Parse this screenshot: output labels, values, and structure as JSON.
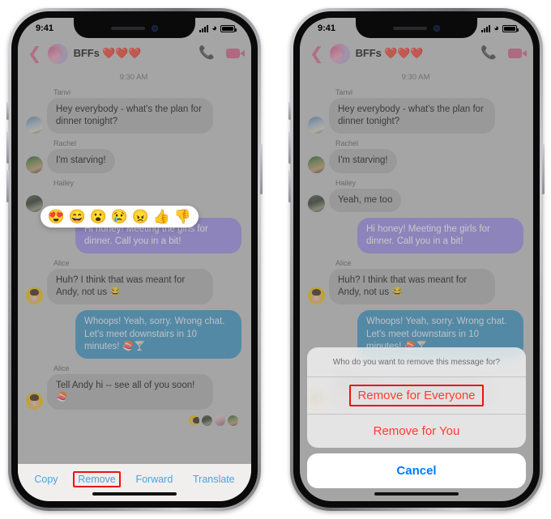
{
  "status_bar": {
    "time": "9:41",
    "signal_icon": "cellular-bars-icon",
    "wifi_icon": "wifi-icon",
    "battery_icon": "battery-full-icon"
  },
  "chat_header": {
    "back_icon": "back-chevron-icon",
    "avatar_icon": "group-avatar",
    "title": "BFFs ❤️❤️❤️",
    "call_icon": "phone-call-icon",
    "video_icon": "video-call-icon"
  },
  "conversation": {
    "timestamp": "9:30 AM",
    "messages": [
      {
        "sender": "Tanvi",
        "text": "Hey everybody - what's the plan for dinner tonight?",
        "side": "in",
        "style": "grey",
        "avatar": "av-tanvi"
      },
      {
        "sender": "Rachel",
        "text": "I'm starving!",
        "side": "in",
        "style": "grey",
        "avatar": "av-rachel"
      },
      {
        "sender": "Hailey",
        "text": "Yeah, me too",
        "side": "in",
        "style": "grey",
        "avatar": "av-hailey"
      },
      {
        "sender": "",
        "text": "Hi honey! Meeting the girls for dinner. Call you in a bit!",
        "side": "out",
        "style": "purple",
        "avatar": ""
      },
      {
        "sender": "Alice",
        "text": "Huh? I think that was meant for Andy, not us 😂",
        "side": "in",
        "style": "grey",
        "avatar": "av-alice"
      },
      {
        "sender": "",
        "text": "Whoops! Yeah, sorry. Wrong chat. Let's meet downstairs in 10 minutes! 🍣🍸",
        "side": "out",
        "style": "blue",
        "avatar": ""
      },
      {
        "sender": "Alice",
        "text": "Tell Andy hi -- see all of you soon! 🍣",
        "side": "in",
        "style": "grey",
        "avatar": "av-alice"
      }
    ],
    "seen_by_label": "seen-by-avatars"
  },
  "reaction_bar": {
    "name": "emoji-reaction-bar",
    "reactions": [
      {
        "name": "heart-eyes-emoji",
        "glyph": "😍"
      },
      {
        "name": "laughing-emoji",
        "glyph": "😄"
      },
      {
        "name": "surprised-emoji",
        "glyph": "😮"
      },
      {
        "name": "sad-tear-emoji",
        "glyph": "😢"
      },
      {
        "name": "angry-emoji",
        "glyph": "😠"
      },
      {
        "name": "thumbs-up-emoji",
        "glyph": "👍"
      },
      {
        "name": "thumbs-down-emoji",
        "glyph": "👎"
      }
    ]
  },
  "action_bar": {
    "actions": [
      {
        "name": "copy-action",
        "label": "Copy",
        "highlighted": false
      },
      {
        "name": "remove-action",
        "label": "Remove",
        "highlighted": true
      },
      {
        "name": "forward-action",
        "label": "Forward",
        "highlighted": false
      },
      {
        "name": "translate-action",
        "label": "Translate",
        "highlighted": false
      }
    ]
  },
  "action_sheet": {
    "title": "Who do you want to remove this message for?",
    "remove_everyone": "Remove for Everyone",
    "remove_you": "Remove for You",
    "cancel": "Cancel"
  },
  "colors": {
    "accent_blue": "#4aa3e0",
    "destructive_red": "#ff3b30",
    "highlight_box": "#ee1111",
    "cancel_blue": "#007aff",
    "bubble_purple": "#9b8ce8",
    "bubble_blue": "#3d95c4",
    "bubble_grey": "#b0b0b0",
    "header_pink": "#d06286"
  }
}
